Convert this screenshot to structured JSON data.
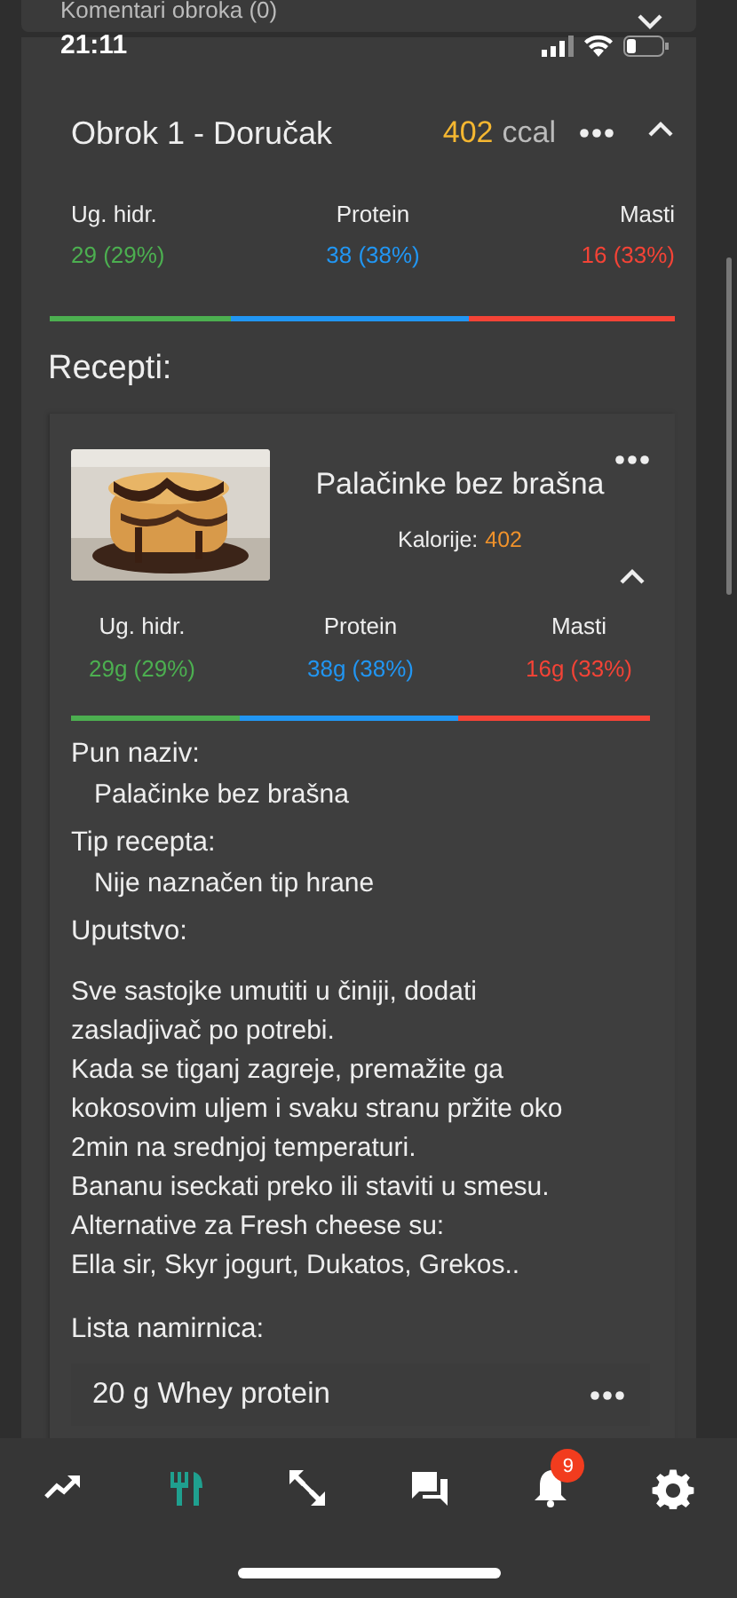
{
  "top_card": {
    "title": "Komentari obroka (0)",
    "expanded": false
  },
  "status_bar": {
    "time": "21:11"
  },
  "meal": {
    "title": "Obrok 1 - Doručak",
    "calories": "402",
    "unit": "ccal",
    "expanded": true,
    "macros": [
      {
        "label": "Ug. hidr.",
        "value": "29 (29%)",
        "color": "#4caf50"
      },
      {
        "label": "Protein",
        "value": "38 (38%)",
        "color": "#2196f3"
      },
      {
        "label": "Masti",
        "value": "16 (33%)",
        "color": "#f44336"
      }
    ]
  },
  "recipes_heading": "Recepti:",
  "recipe": {
    "image": {
      "kind": "picture"
    },
    "title": "Palačinke bez brašna",
    "calories_label": "Kalorije:",
    "calories": "402",
    "expanded": true,
    "macros": [
      {
        "label": "Ug. hidr.",
        "value": "29g (29%)",
        "color": "#4caf50"
      },
      {
        "label": "Protein",
        "value": "38g (38%)",
        "color": "#2196f3"
      },
      {
        "label": "Masti",
        "value": "16g (33%)",
        "color": "#f44336"
      }
    ],
    "fields": [
      {
        "label": "Pun naziv:",
        "value": "Palačinke bez brašna"
      },
      {
        "label": "Tip recepta:",
        "value": "Nije naznačen tip hrane"
      }
    ],
    "instructions_label": "Uputstvo:",
    "instructions": [
      "Sve sastojke umutiti u činiji, dodati zasladjivač po potrebi.",
      "Kada se tiganj zagreje, premažite ga kokosovim uljem i svaku stranu pržite oko 2min na srednjoj temperaturi.",
      "Bananu iseckati preko ili staviti u smesu.",
      "Alternative za Fresh cheese su:",
      "Ella sir, Skyr jogurt, Dukatos, Grekos.."
    ],
    "ingredients_label": "Lista namirnica:",
    "ingredients": [
      {
        "name": "20 g Whey protein"
      }
    ]
  },
  "nav": [
    {
      "kind": "trend",
      "selected": false
    },
    {
      "kind": "cutlery",
      "selected": true
    },
    {
      "kind": "expand",
      "selected": false
    },
    {
      "kind": "chat",
      "selected": false
    },
    {
      "kind": "bell",
      "selected": false,
      "badge": "9"
    },
    {
      "kind": "gear",
      "selected": false
    }
  ]
}
